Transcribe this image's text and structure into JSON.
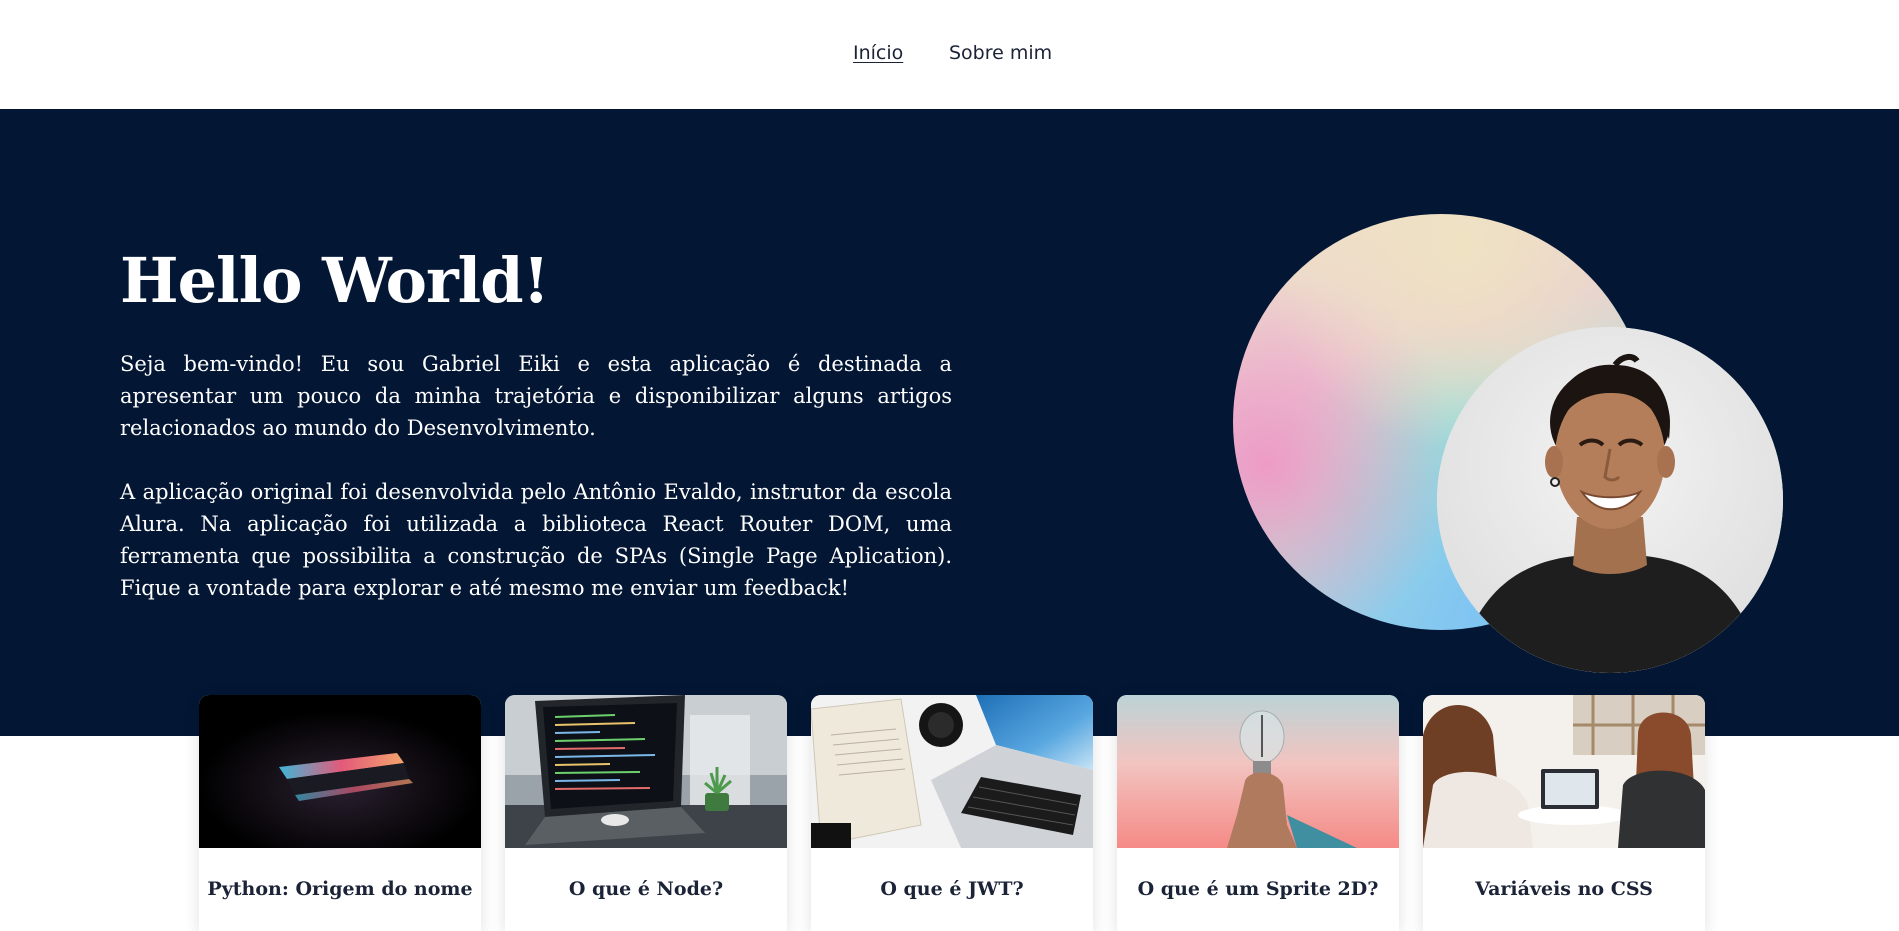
{
  "nav": {
    "items": [
      {
        "label": "Início",
        "active": true
      },
      {
        "label": "Sobre mim",
        "active": false
      }
    ]
  },
  "hero": {
    "title": "Hello World!",
    "paragraphs": [
      "Seja bem-vindo! Eu sou Gabriel Eiki e esta aplicação é destinada a apresentar um pouco da minha trajetória e disponibilizar alguns artigos relacionados ao mundo do Desenvolvimento.",
      "A aplicação original foi desenvolvida pelo Antônio Evaldo, instrutor da escola Alura. Na aplicação foi utilizada a biblioteca React Router DOM, uma ferramenta que possibilita a construção de SPAs (Single Page Aplication). Fique a vontade para explorar e até mesmo me enviar um feedback!"
    ],
    "background_color": "#031634"
  },
  "posts": [
    {
      "title": "Python: Origem do nome",
      "image": "laptop-dark-neon"
    },
    {
      "title": "O que é Node?",
      "image": "laptop-code-desk"
    },
    {
      "title": "O que é JWT?",
      "image": "laptop-book-camera"
    },
    {
      "title": "O que é um Sprite 2D?",
      "image": "hand-lightbulb"
    },
    {
      "title": "Variáveis no CSS",
      "image": "two-women-laptop"
    }
  ],
  "colors": {
    "text_dark": "#1b2337",
    "accent_navy": "#031634"
  }
}
